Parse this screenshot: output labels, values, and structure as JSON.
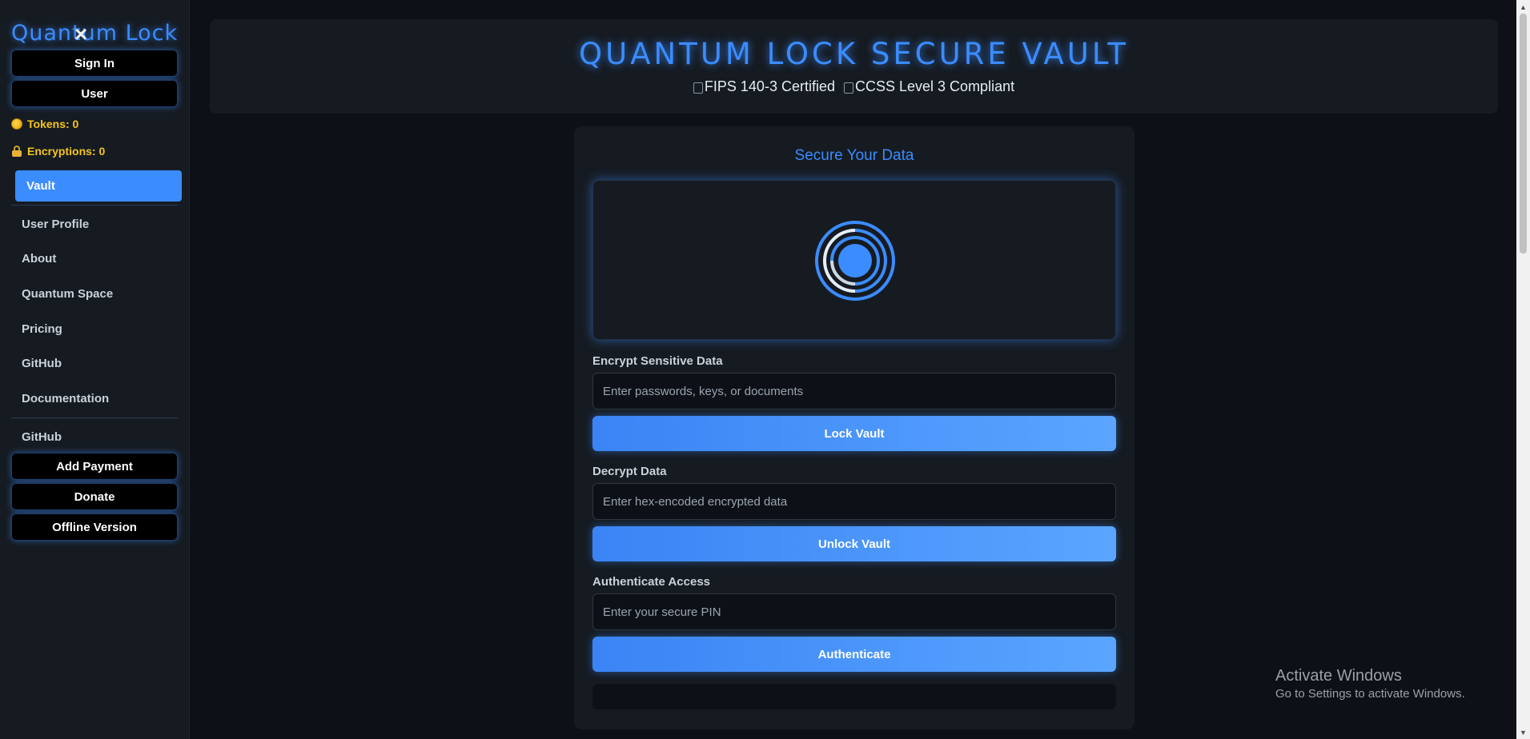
{
  "sidebar": {
    "brand": "Quantum Lock",
    "sign_in": "Sign In",
    "user": "User",
    "tokens": "Tokens: 0",
    "encryptions": "Encryptions: 0",
    "active_nav": "Vault",
    "nav": [
      "User Profile",
      "About",
      "Quantum Space",
      "Pricing",
      "GitHub",
      "Documentation"
    ],
    "secondary_nav": "GitHub",
    "add_payment": "Add Payment",
    "donate": "Donate",
    "offline": "Offline Version"
  },
  "header": {
    "title": "QUANTUM LOCK SECURE VAULT",
    "badge1": "FIPS 140-3 Certified",
    "badge2": "CCSS Level 3 Compliant"
  },
  "card": {
    "title": "Secure Your Data",
    "encrypt_label": "Encrypt Sensitive Data",
    "encrypt_placeholder": "Enter passwords, keys, or documents",
    "lock_button": "Lock Vault",
    "decrypt_label": "Decrypt Data",
    "decrypt_placeholder": "Enter hex-encoded encrypted data",
    "unlock_button": "Unlock Vault",
    "auth_label": "Authenticate Access",
    "auth_placeholder": "Enter your secure PIN",
    "auth_button": "Authenticate"
  },
  "watermark": {
    "title": "Activate Windows",
    "subtitle": "Go to Settings to activate Windows."
  },
  "colors": {
    "accent": "#3b8cff",
    "background": "#0d1117",
    "panel": "#161b22",
    "stat": "#f5c518"
  },
  "icons": {
    "close": "close-icon",
    "coin": "coin-icon",
    "lock": "lock-icon",
    "vault": "vault-dial-icon"
  }
}
